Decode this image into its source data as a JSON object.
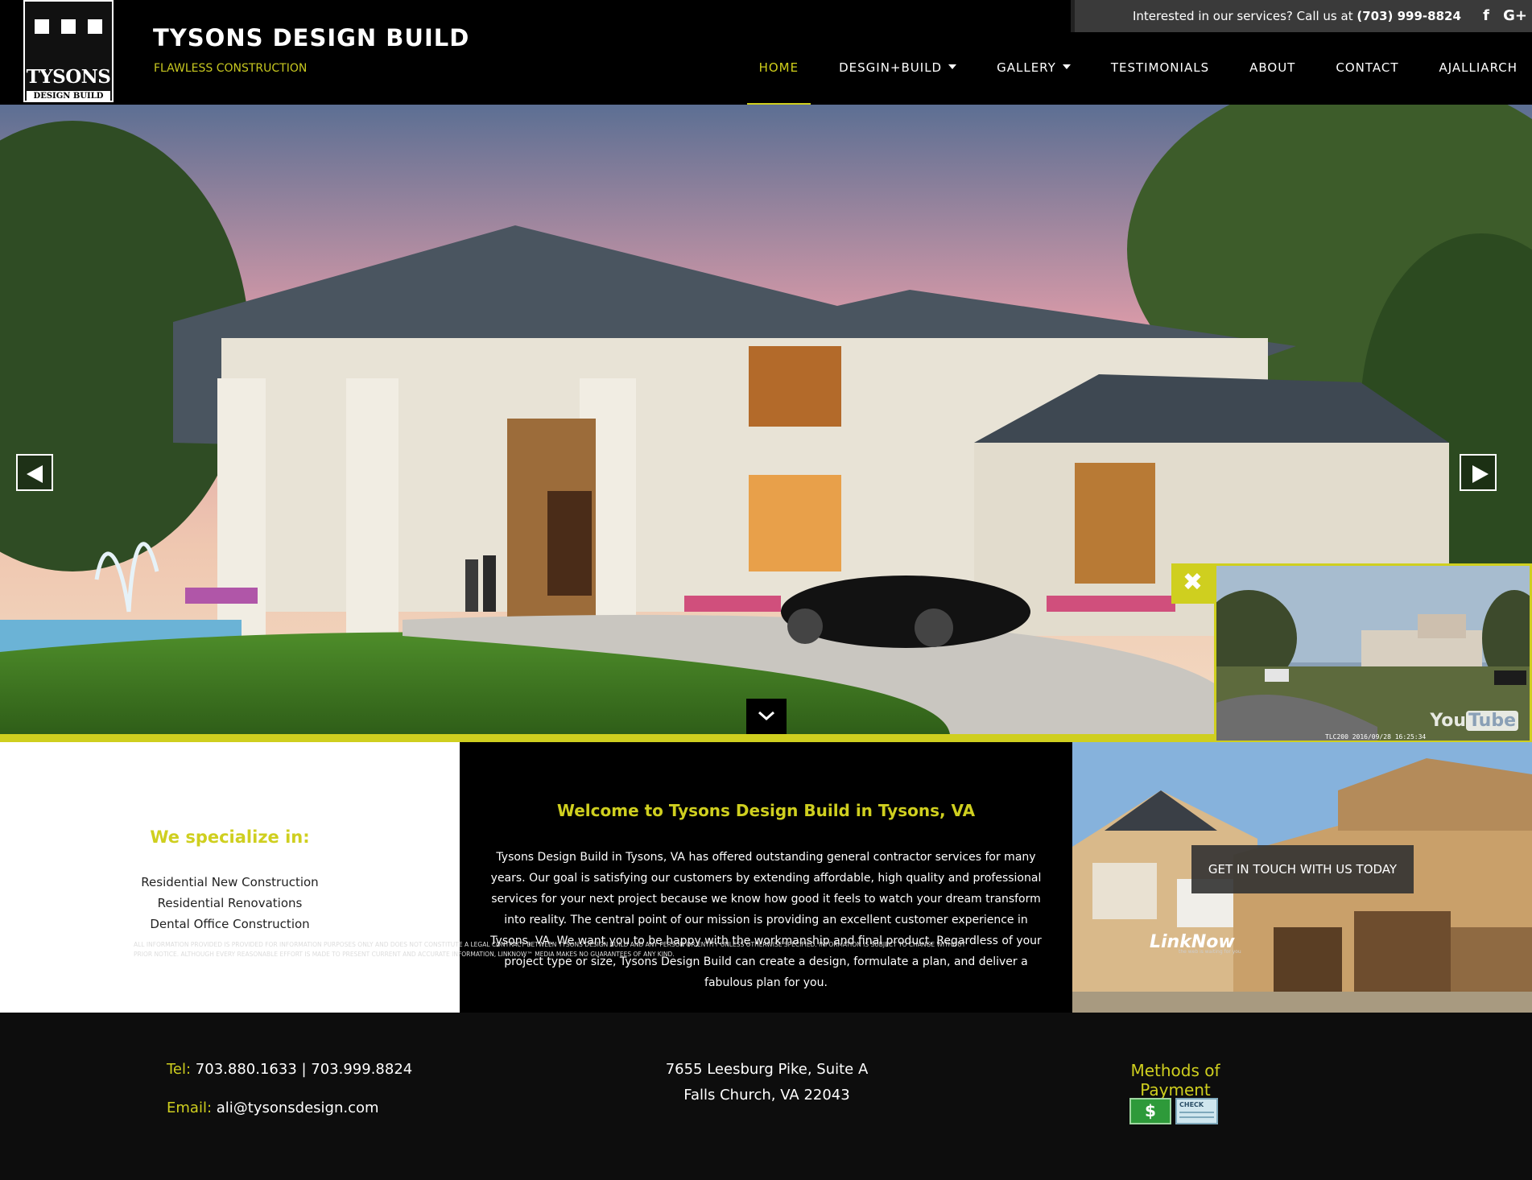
{
  "header": {
    "logo_text": "TYSONS",
    "logo_sub": "DESIGN BUILD",
    "site_title": "TYSONS DESIGN BUILD",
    "tagline": "FLAWLESS CONSTRUCTION"
  },
  "contact_bar": {
    "prefix": "Interested in our services? Call us at ",
    "phone": "(703) 999-8824",
    "social": [
      {
        "name": "facebook-icon",
        "glyph": "f"
      },
      {
        "name": "google-plus-icon",
        "glyph": "G+"
      }
    ]
  },
  "nav": {
    "items": [
      {
        "label": "HOME",
        "active": true,
        "dropdown": false
      },
      {
        "label": "DESGIN+BUILD",
        "active": false,
        "dropdown": true
      },
      {
        "label": "GALLERY",
        "active": false,
        "dropdown": true
      },
      {
        "label": "TESTIMONIALS",
        "active": false,
        "dropdown": false
      },
      {
        "label": "ABOUT",
        "active": false,
        "dropdown": false
      },
      {
        "label": "CONTACT",
        "active": false,
        "dropdown": false
      },
      {
        "label": "AJALLIARCH",
        "active": false,
        "dropdown": false
      }
    ]
  },
  "video": {
    "close_glyph": "✖",
    "brand_you": "You",
    "brand_tube": "Tube",
    "timestamp": "TLC200  2016/09/28  16:25:34"
  },
  "specialize": {
    "heading": "We specialize in:",
    "items": [
      "Residential New Construction",
      "Residential Renovations",
      "Dental Office Construction"
    ]
  },
  "welcome": {
    "heading": "Welcome to Tysons Design Build in Tysons, VA",
    "body": "Tysons Design Build in Tysons, VA has offered outstanding general contractor services for many years. Our goal is satisfying our customers by extending affordable, high quality and professional services for your next project because we know how good it feels to watch your dream transform into reality. The central point of our mission is providing an excellent customer experience in Tysons, VA. We want you to be happy with the workmanship and final product. Regardless of your project type or size, Tysons Design Build can create a design, formulate a plan, and deliver a fabulous plan for you."
  },
  "cta": {
    "label": "GET IN TOUCH WITH US TODAY"
  },
  "footer": {
    "tel_label": "Tel:",
    "tel_value": " 703.880.1633 | 703.999.8824",
    "email_label": "Email:",
    "email_value": " ali@tysonsdesign.com",
    "address_line1": "7655 Leesburg Pike, Suite A",
    "address_line2": "Falls Church, VA 22043",
    "payment_title": "Methods of Payment",
    "payment_cash": "$",
    "payment_check": "CHECK",
    "disclaimer": "All information provided is provided for information purposes only and does not constitute a legal contract between Tysons Design Build and any person or entity unless otherwise specified. Information is subject to change without prior notice. Although every reasonable effort is made to present current and accurate information, LinkNow™ Media makes no guarantees of any kind.",
    "linknow": "LinkNow",
    "linknow_tagline": "the web is waiting for you"
  },
  "colors": {
    "accent": "#cfcf1f",
    "background": "#000000"
  }
}
